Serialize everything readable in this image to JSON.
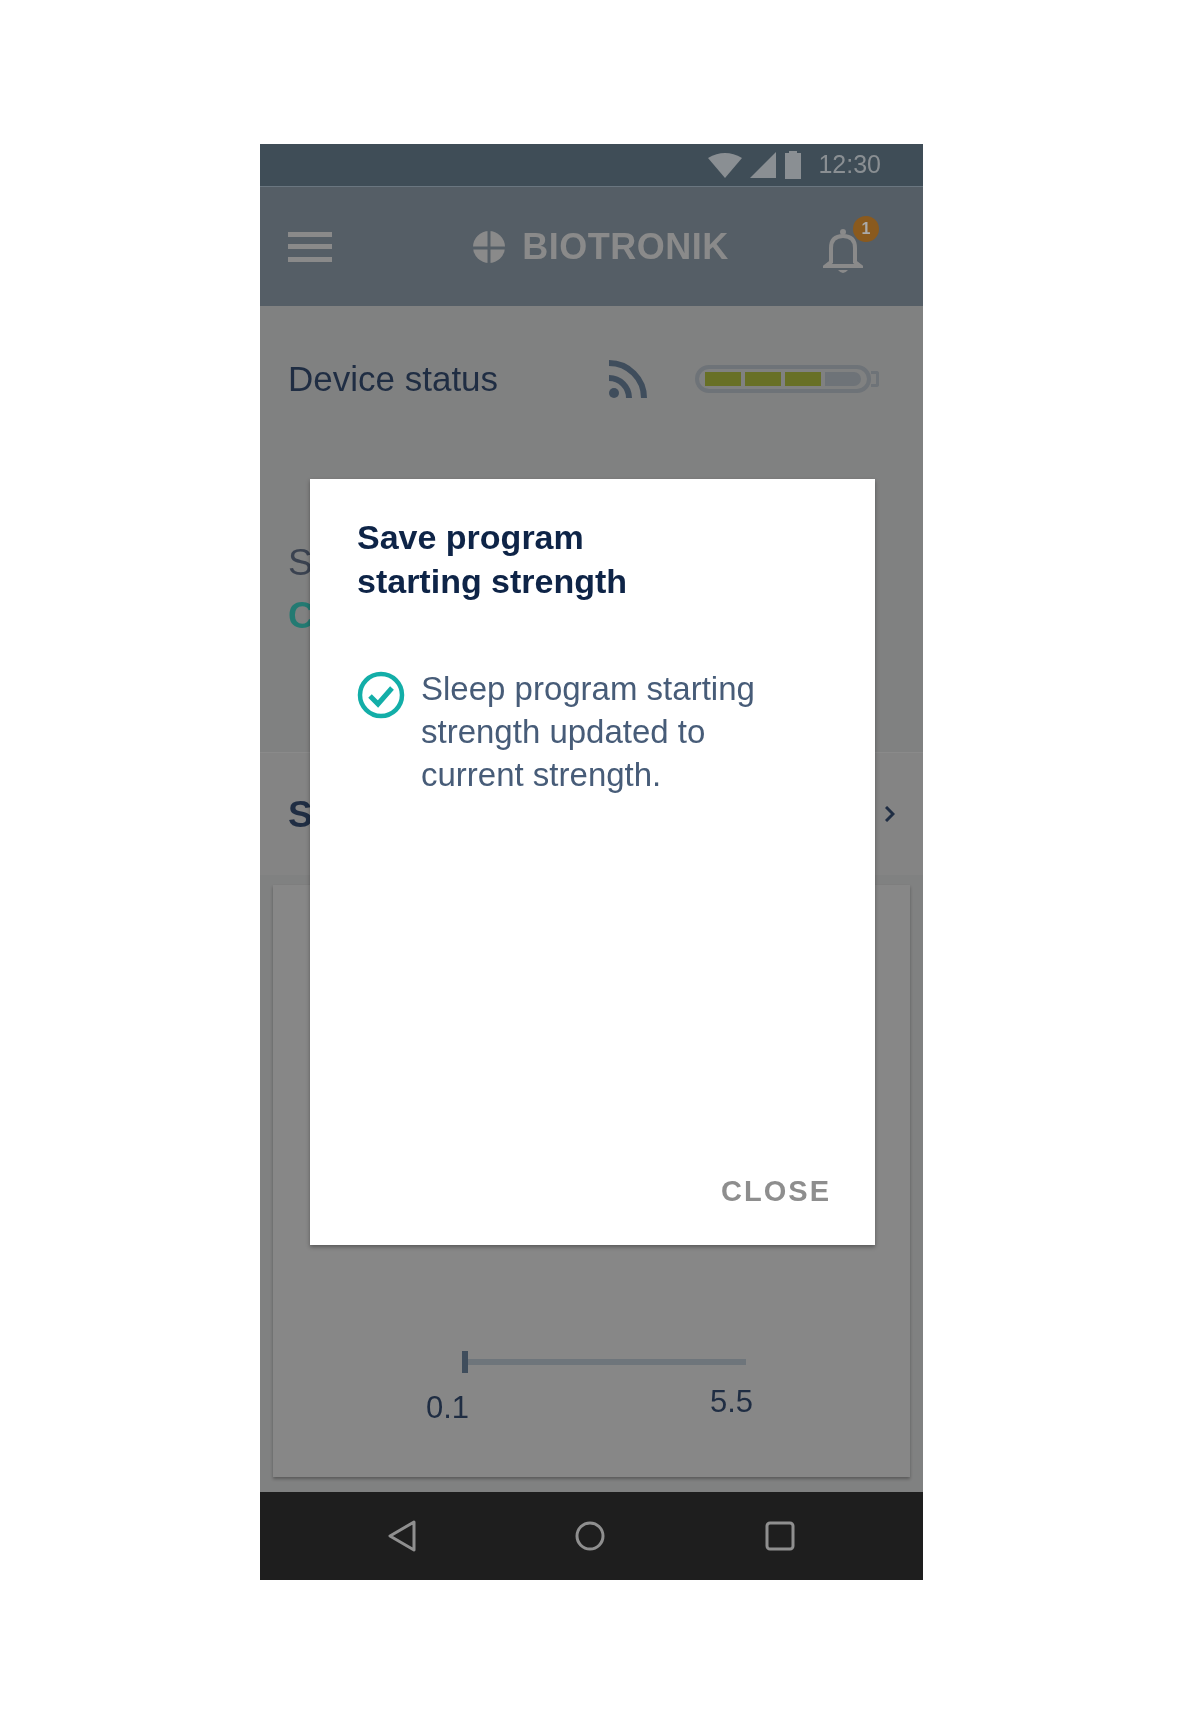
{
  "status_bar": {
    "time": "12:30"
  },
  "app_bar": {
    "brand": "BIOTRONIK",
    "notification_count": "1"
  },
  "device_status": {
    "label": "Device status",
    "battery": {
      "level": 0.75
    }
  },
  "background": {
    "fragments": [
      {
        "kind": "label",
        "text": "S"
      },
      {
        "kind": "value",
        "text": "C"
      },
      {
        "kind": "heading",
        "text": "S"
      }
    ]
  },
  "slider": {
    "level": 0,
    "min_label": "0.1",
    "max_label": "5.5"
  },
  "dialog": {
    "title": "Save program starting strength",
    "message": "Sleep program starting strength updated to current strength.",
    "button": "CLOSE"
  }
}
